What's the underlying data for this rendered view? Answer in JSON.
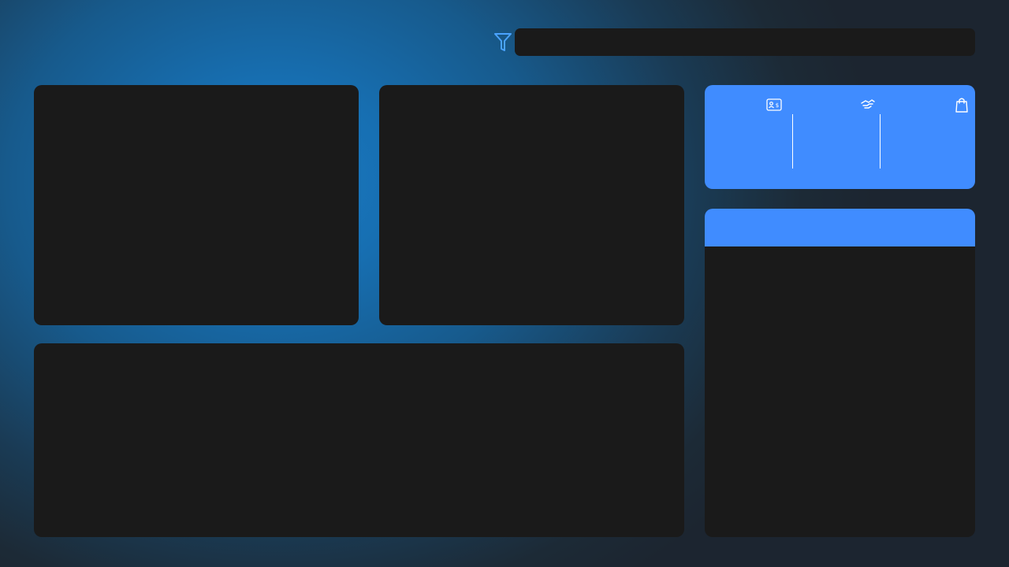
{
  "filter": {
    "icon": "filter-funnel-icon",
    "icon_color": "#4aa3ff",
    "value": ""
  },
  "kpi_card": {
    "background": "#408cff",
    "icons": [
      "id-card-icon",
      "handshake-icon",
      "shopping-bag-icon"
    ]
  },
  "list_panel": {
    "header_color": "#408cff",
    "header_text": ""
  },
  "colors": {
    "panel": "#1a1a1a",
    "accent": "#408cff",
    "background_center": "#1979c2",
    "background_edge": "#1c2530"
  }
}
